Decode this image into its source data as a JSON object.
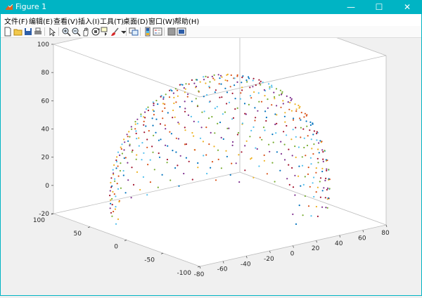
{
  "window": {
    "title": "Figure 1",
    "min_glyph": "—",
    "max_glyph": "☐",
    "close_glyph": "✕"
  },
  "menu": [
    "文件(F)",
    "编辑(E)",
    "查看(V)",
    "插入(I)",
    "工具(T)",
    "桌面(D)",
    "窗口(W)",
    "帮助(H)"
  ],
  "toolbar": [
    "new-figure-icon",
    "open-file-icon",
    "save-icon",
    "print-icon",
    "pointer-icon",
    "zoom-in-icon",
    "zoom-out-icon",
    "pan-icon",
    "rotate-3d-icon",
    "data-cursor-icon",
    "brush-icon",
    "link-plot-icon",
    "colorbar-icon",
    "legend-icon",
    "hide-plot-tools-icon",
    "show-plot-tools-icon"
  ],
  "chart_data": {
    "type": "scatter3d",
    "title": "",
    "xlabel": "",
    "ylabel": "",
    "zlabel": "",
    "xlim": [
      -80,
      80
    ],
    "ylim": [
      -100,
      100
    ],
    "zlim": [
      -20,
      100
    ],
    "x_ticks": [
      "-80",
      "-60",
      "-40",
      "-20",
      "0",
      "20",
      "40",
      "60",
      "80"
    ],
    "y_ticks": [
      "-100",
      "-50",
      "0",
      "50",
      "100"
    ],
    "z_ticks": [
      "-20",
      "0",
      "20",
      "40",
      "60",
      "80",
      "100"
    ],
    "grid": false,
    "box": true,
    "series": {
      "shape": "spherical shell of dots, radius 80 centred at origin, cut open on the -x,-y side",
      "radius": 80,
      "colors": [
        "#0072bd",
        "#d95319",
        "#edb120",
        "#7e2f8e",
        "#77ac30",
        "#4dbeee",
        "#a2142f"
      ]
    }
  }
}
